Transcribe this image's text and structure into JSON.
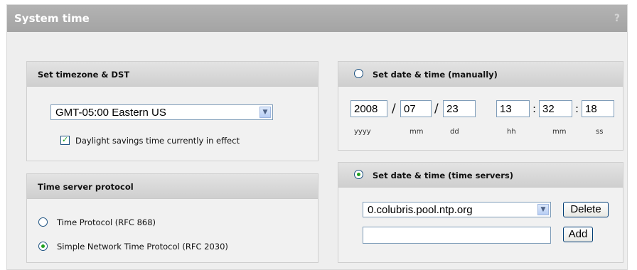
{
  "header": {
    "title": "System time",
    "help": "?"
  },
  "timezone_panel": {
    "title": "Set timezone & DST",
    "timezone_value": "GMT-05:00 Eastern US",
    "dst_label": "Daylight savings time currently in effect",
    "dst_checked": true
  },
  "protocol_panel": {
    "title": "Time server protocol",
    "options": [
      {
        "label": "Time Protocol (RFC 868)",
        "selected": false
      },
      {
        "label": "Simple Network Time Protocol (RFC 2030)",
        "selected": true
      }
    ]
  },
  "manual_panel": {
    "title": "Set date & time (manually)",
    "selected": false,
    "date": {
      "year": "2008",
      "month": "07",
      "day": "23"
    },
    "time": {
      "hour": "13",
      "minute": "32",
      "second": "18"
    },
    "sep_date": "/",
    "sep_time": ":",
    "labels": {
      "yyyy": "yyyy",
      "mm": "mm",
      "dd": "dd",
      "hh": "hh",
      "min": "mm",
      "ss": "ss"
    }
  },
  "servers_panel": {
    "title": "Set date & time (time servers)",
    "selected": true,
    "server_value": "0.colubris.pool.ntp.org",
    "new_server_value": "",
    "delete_label": "Delete",
    "add_label": "Add"
  },
  "colors": {
    "selected_mark": "#21a121",
    "titlebar": "#a8a8a8"
  }
}
